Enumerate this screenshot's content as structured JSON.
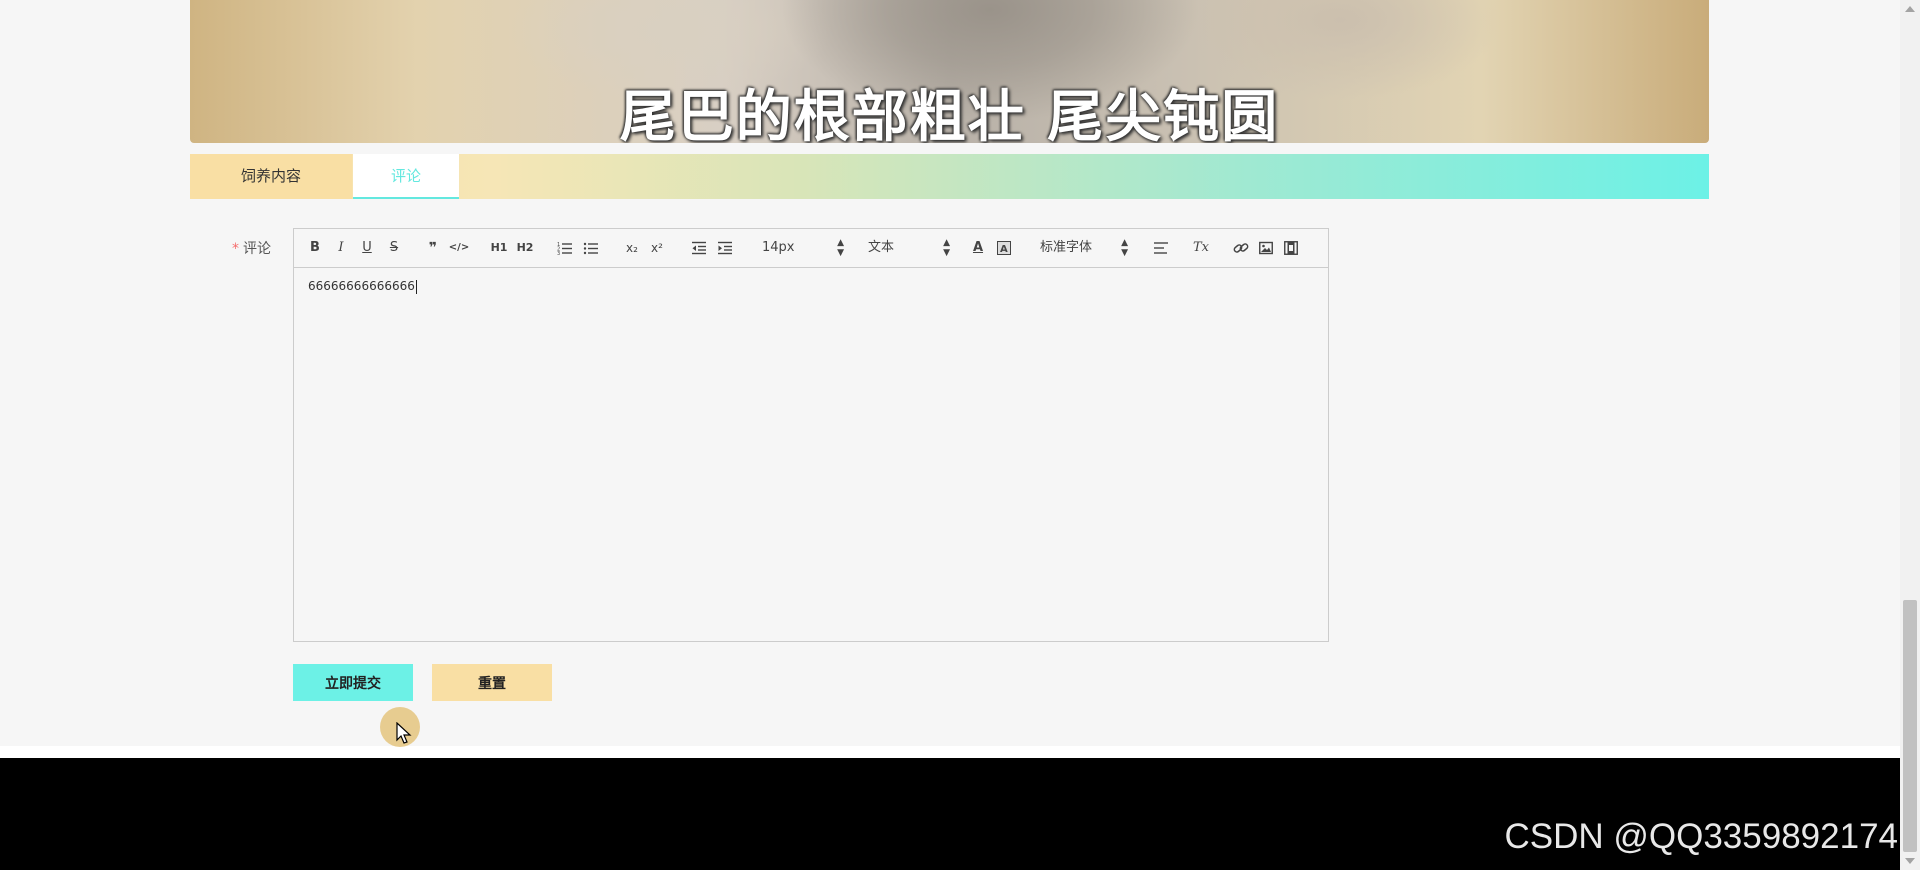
{
  "hero": {
    "caption": "尾巴的根部粗壮 尾尖钝圆"
  },
  "tabs": [
    {
      "label": "饲养内容",
      "active": false
    },
    {
      "label": "评论",
      "active": true
    }
  ],
  "form": {
    "label": "评论",
    "required_mark": "*",
    "editor_content": "66666666666666"
  },
  "toolbar": {
    "bold": "B",
    "italic": "I",
    "underline": "U",
    "strike": "S",
    "blockquote": "❞",
    "code": "</>",
    "h1": "H1",
    "h2": "H2",
    "subscript": "x₂",
    "superscript": "x²",
    "size_value": "14px",
    "header_value": "文本",
    "font_value": "标准字体",
    "color_letter": "A",
    "clean_icon": "Tx"
  },
  "buttons": {
    "submit": "立即提交",
    "reset": "重置"
  },
  "watermark": "CSDN @QQ3359892174",
  "colors": {
    "accent_cyan": "#6cf1e6",
    "accent_yellow": "#f9dfa4",
    "footer": "#000000"
  },
  "icons": [
    "ordered-list-icon",
    "bullet-list-icon",
    "outdent-icon",
    "indent-icon",
    "font-color-icon",
    "background-color-icon",
    "align-icon",
    "clear-format-icon",
    "link-icon",
    "image-icon",
    "video-icon",
    "pointer-cursor-icon"
  ]
}
